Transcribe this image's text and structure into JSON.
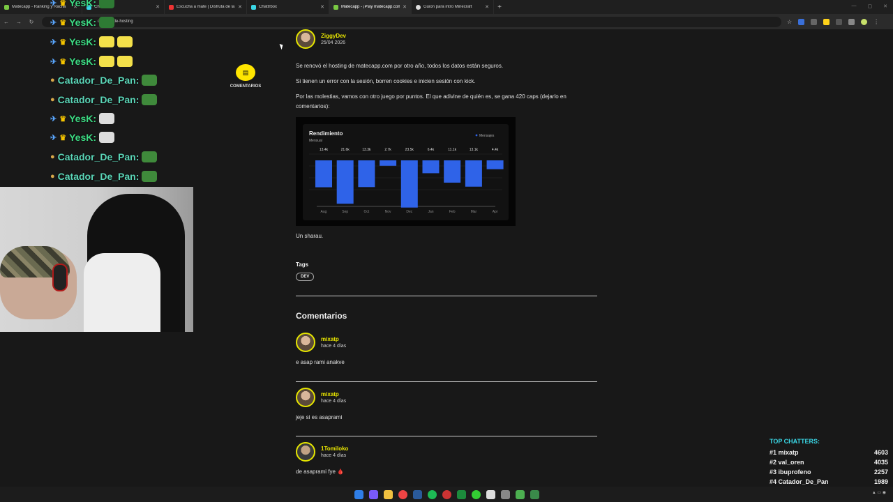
{
  "tabs": [
    {
      "title": "Matecapp - Ranking y Racha",
      "active": false
    },
    {
      "title": "Chattrbox",
      "active": false
    },
    {
      "title": "Escucha a mate | Disfruta de la",
      "active": false
    },
    {
      "title": "Chattrbox",
      "active": false
    },
    {
      "title": "Matecapp - ¡Play matecapp.com",
      "active": true
    },
    {
      "title": "Guion para intro Minecraft",
      "active": false
    }
  ],
  "address": {
    "url_fragment": "ovacion-de-hosting"
  },
  "comments_fab": {
    "label": "COMENTARIOS"
  },
  "post": {
    "author": "ZiggyDev",
    "date": "25/04 2026",
    "paragraphs": [
      "Se renovó el hosting de matecapp.com por otro año, todos los datos están seguros.",
      "Si tienen un error con la sesión, borren cookies e inicien sesión con kick.",
      "Por las molestias, vamos con otro juego por puntos. El que adivine de quién es, se gana 420 caps (dejarlo en comentarios):"
    ],
    "closing": "Un sharau.",
    "tags_heading": "Tags",
    "tags": [
      "DEV"
    ]
  },
  "chart_data": {
    "type": "bar",
    "title": "Rendimiento",
    "subtitle": "Mensual",
    "legend": [
      "Mensajes"
    ],
    "categories": [
      "Aug",
      "Sep",
      "Oct",
      "Nov",
      "Dec",
      "Jan",
      "Feb",
      "Mar",
      "Apr"
    ],
    "value_labels": [
      "13.4k",
      "21.6k",
      "13.3k",
      "2.7k",
      "23.5k",
      "6.4k",
      "11.1k",
      "13.1k",
      "4.4k"
    ],
    "values": [
      13.4,
      21.6,
      13.3,
      2.7,
      23.5,
      6.4,
      11.1,
      13.1,
      4.4
    ],
    "color": "#2f63e8",
    "ylim": [
      0,
      25
    ]
  },
  "comments_heading": "Comentarios",
  "comments": [
    {
      "author": "mixatp",
      "time": "hace 4 días",
      "text": "e asap rami anakve"
    },
    {
      "author": "mixatp",
      "time": "hace 4 días",
      "text": "jeje si es asaprami"
    },
    {
      "author": "1Tomiloko",
      "time": "hace 4 días",
      "text": "de asaprami fye 🩸"
    }
  ],
  "chat": [
    {
      "user": "YesK:",
      "type": "a"
    },
    {
      "user": "YesK:",
      "type": "a"
    },
    {
      "user": "Catador_De_Pan:",
      "type": "b"
    },
    {
      "user": "Catador_De_Pan:",
      "type": "b"
    },
    {
      "user": "YesK:",
      "type": "a"
    },
    {
      "user": "YesK:",
      "type": "a"
    },
    {
      "user": "Catador_De_Pan:",
      "type": "b"
    },
    {
      "user": "Catador_De_Pan:",
      "type": "b"
    }
  ],
  "top_chatters": {
    "title": "TOP CHATTERS:",
    "rows": [
      {
        "rank": "#1",
        "name": "mixatp",
        "count": "4603"
      },
      {
        "rank": "#2",
        "name": "val_oren",
        "count": "4035"
      },
      {
        "rank": "#3",
        "name": "ibuprofeno",
        "count": "2257"
      },
      {
        "rank": "#4",
        "name": "Catador_De_Pan",
        "count": "1989"
      },
      {
        "rank": "#5",
        "name": "joseandeinthedarking",
        "count": "1632"
      }
    ]
  }
}
